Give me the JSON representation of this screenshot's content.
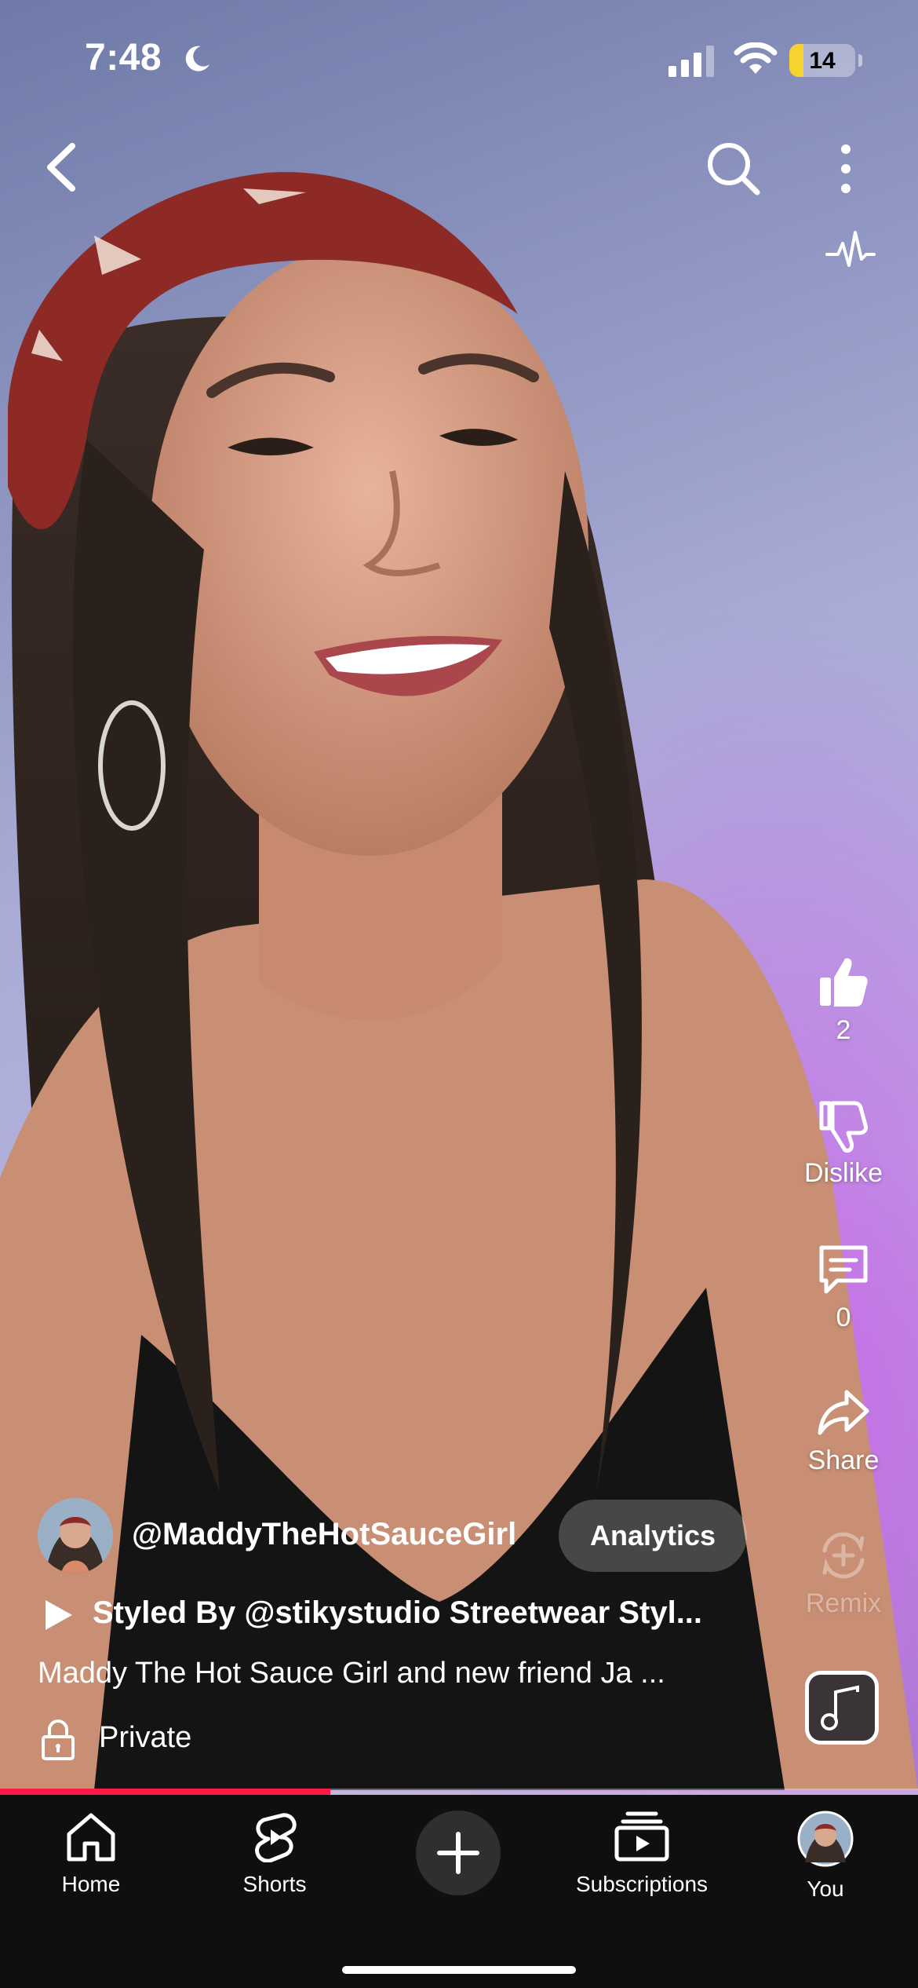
{
  "status_bar": {
    "time": "7:48",
    "battery": "14"
  },
  "actions": {
    "like_count": "2",
    "dislike_label": "Dislike",
    "comment_count": "0",
    "share_label": "Share",
    "remix_label": "Remix"
  },
  "video": {
    "channel_handle": "@MaddyTheHotSauceGirl",
    "analytics_label": "Analytics",
    "title": "Styled By @stikystudio Streetwear Styl...",
    "description": "Maddy The Hot Sauce Girl and new friend Ja ...",
    "privacy": "Private",
    "progress": 0.36
  },
  "nav": {
    "items": [
      {
        "label": "Home",
        "icon": "home-icon"
      },
      {
        "label": "Shorts",
        "icon": "shorts-icon"
      },
      {
        "label": "",
        "icon": "create-icon"
      },
      {
        "label": "Subscriptions",
        "icon": "subscriptions-icon"
      },
      {
        "label": "You",
        "icon": "avatar"
      }
    ]
  },
  "colors": {
    "progress": "#ff1a4a",
    "battery_low": "#f7d330",
    "nav_bg": "#0f0f0f"
  }
}
